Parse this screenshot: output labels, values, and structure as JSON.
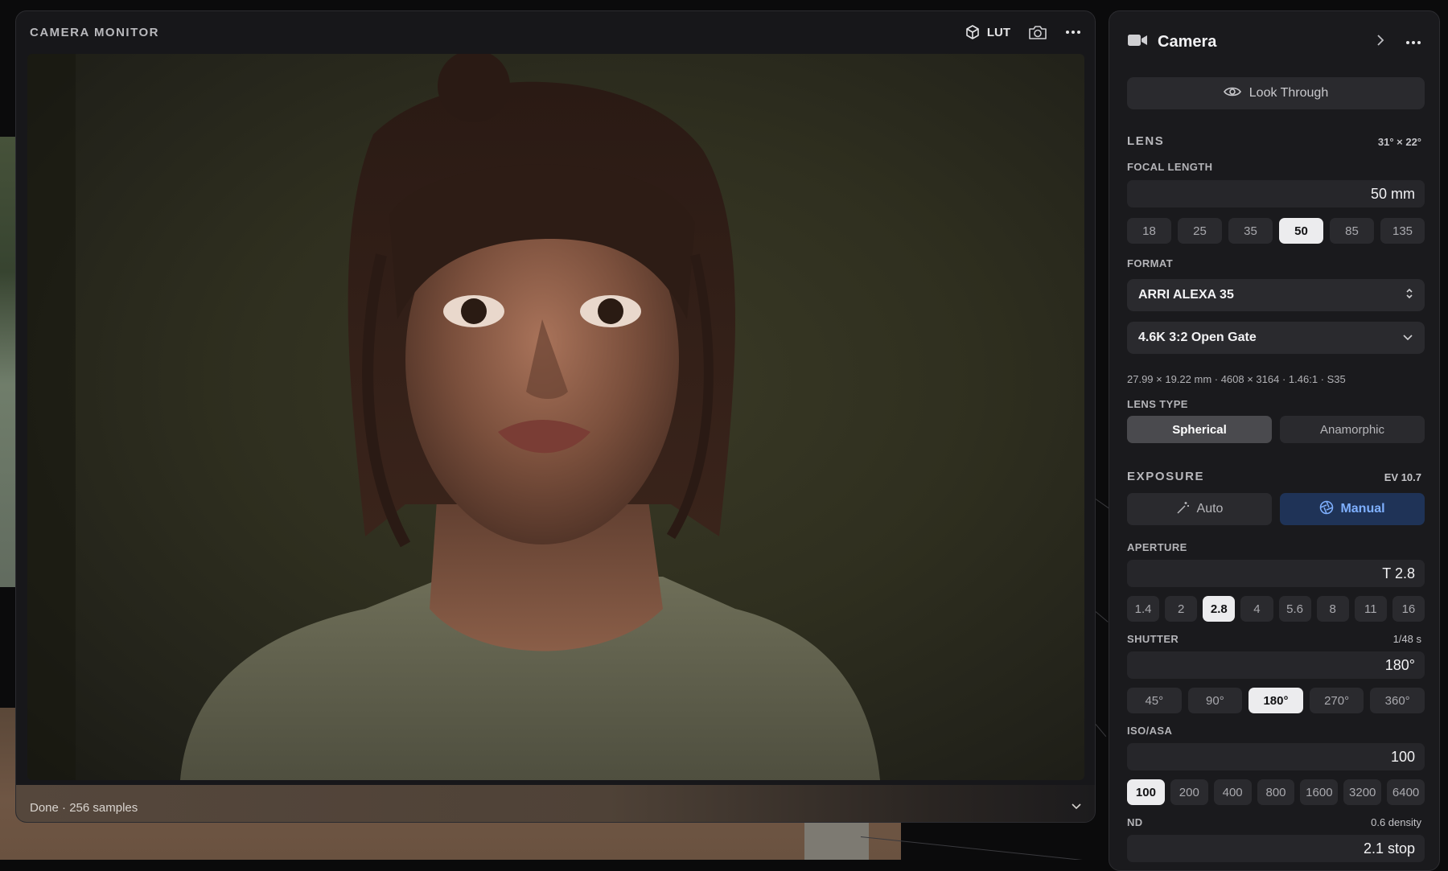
{
  "monitor": {
    "title": "CAMERA MONITOR",
    "lut_label": "LUT",
    "status": "Done · 256 samples",
    "render_progress": 1.0
  },
  "inspector": {
    "title": "Camera",
    "look_through": "Look Through",
    "lens": {
      "title": "LENS",
      "fov": "31° × 22°",
      "focal_label": "FOCAL LENGTH",
      "focal_value": "50 mm",
      "focal_presets": [
        "18",
        "25",
        "35",
        "50",
        "85",
        "135"
      ],
      "focal_selected": "50",
      "format_label": "FORMAT",
      "format_value": "ARRI ALEXA 35",
      "mode_value": "4.6K 3:2 Open Gate",
      "specs": "27.99 × 19.22 mm · 4608 × 3164 · 1.46:1 · S35",
      "lens_type_label": "LENS TYPE",
      "lens_types": [
        "Spherical",
        "Anamorphic"
      ],
      "lens_type_selected": "Spherical"
    },
    "exposure": {
      "title": "EXPOSURE",
      "ev": "EV 10.7",
      "modes": [
        "Auto",
        "Manual"
      ],
      "mode_selected": "Manual",
      "aperture_label": "APERTURE",
      "aperture_value": "T 2.8",
      "aperture_presets": [
        "1.4",
        "2",
        "2.8",
        "4",
        "5.6",
        "8",
        "11",
        "16"
      ],
      "aperture_selected": "2.8",
      "shutter_label": "SHUTTER",
      "shutter_time": "1/48 s",
      "shutter_value": "180°",
      "shutter_presets": [
        "45°",
        "90°",
        "180°",
        "270°",
        "360°"
      ],
      "shutter_selected": "180°",
      "iso_label": "ISO/ASA",
      "iso_value": "100",
      "iso_presets": [
        "100",
        "200",
        "400",
        "800",
        "1600",
        "3200",
        "6400"
      ],
      "iso_selected": "100",
      "nd_label": "ND",
      "nd_density": "0.6 density",
      "nd_value": "2.1 stop"
    }
  },
  "colors": {
    "accent_blue": "#7fb0ff",
    "panel_bg": "#1a1a1d",
    "chip_bg": "#2a2a2e",
    "chip_active": "#ececee"
  },
  "icons": [
    "cube-icon",
    "camera-snapshot-icon",
    "more-icon",
    "video-camera-icon",
    "chevron-right-icon",
    "eye-icon",
    "select-updown-icon",
    "chevron-down-icon",
    "magic-wand-icon",
    "aperture-icon"
  ]
}
